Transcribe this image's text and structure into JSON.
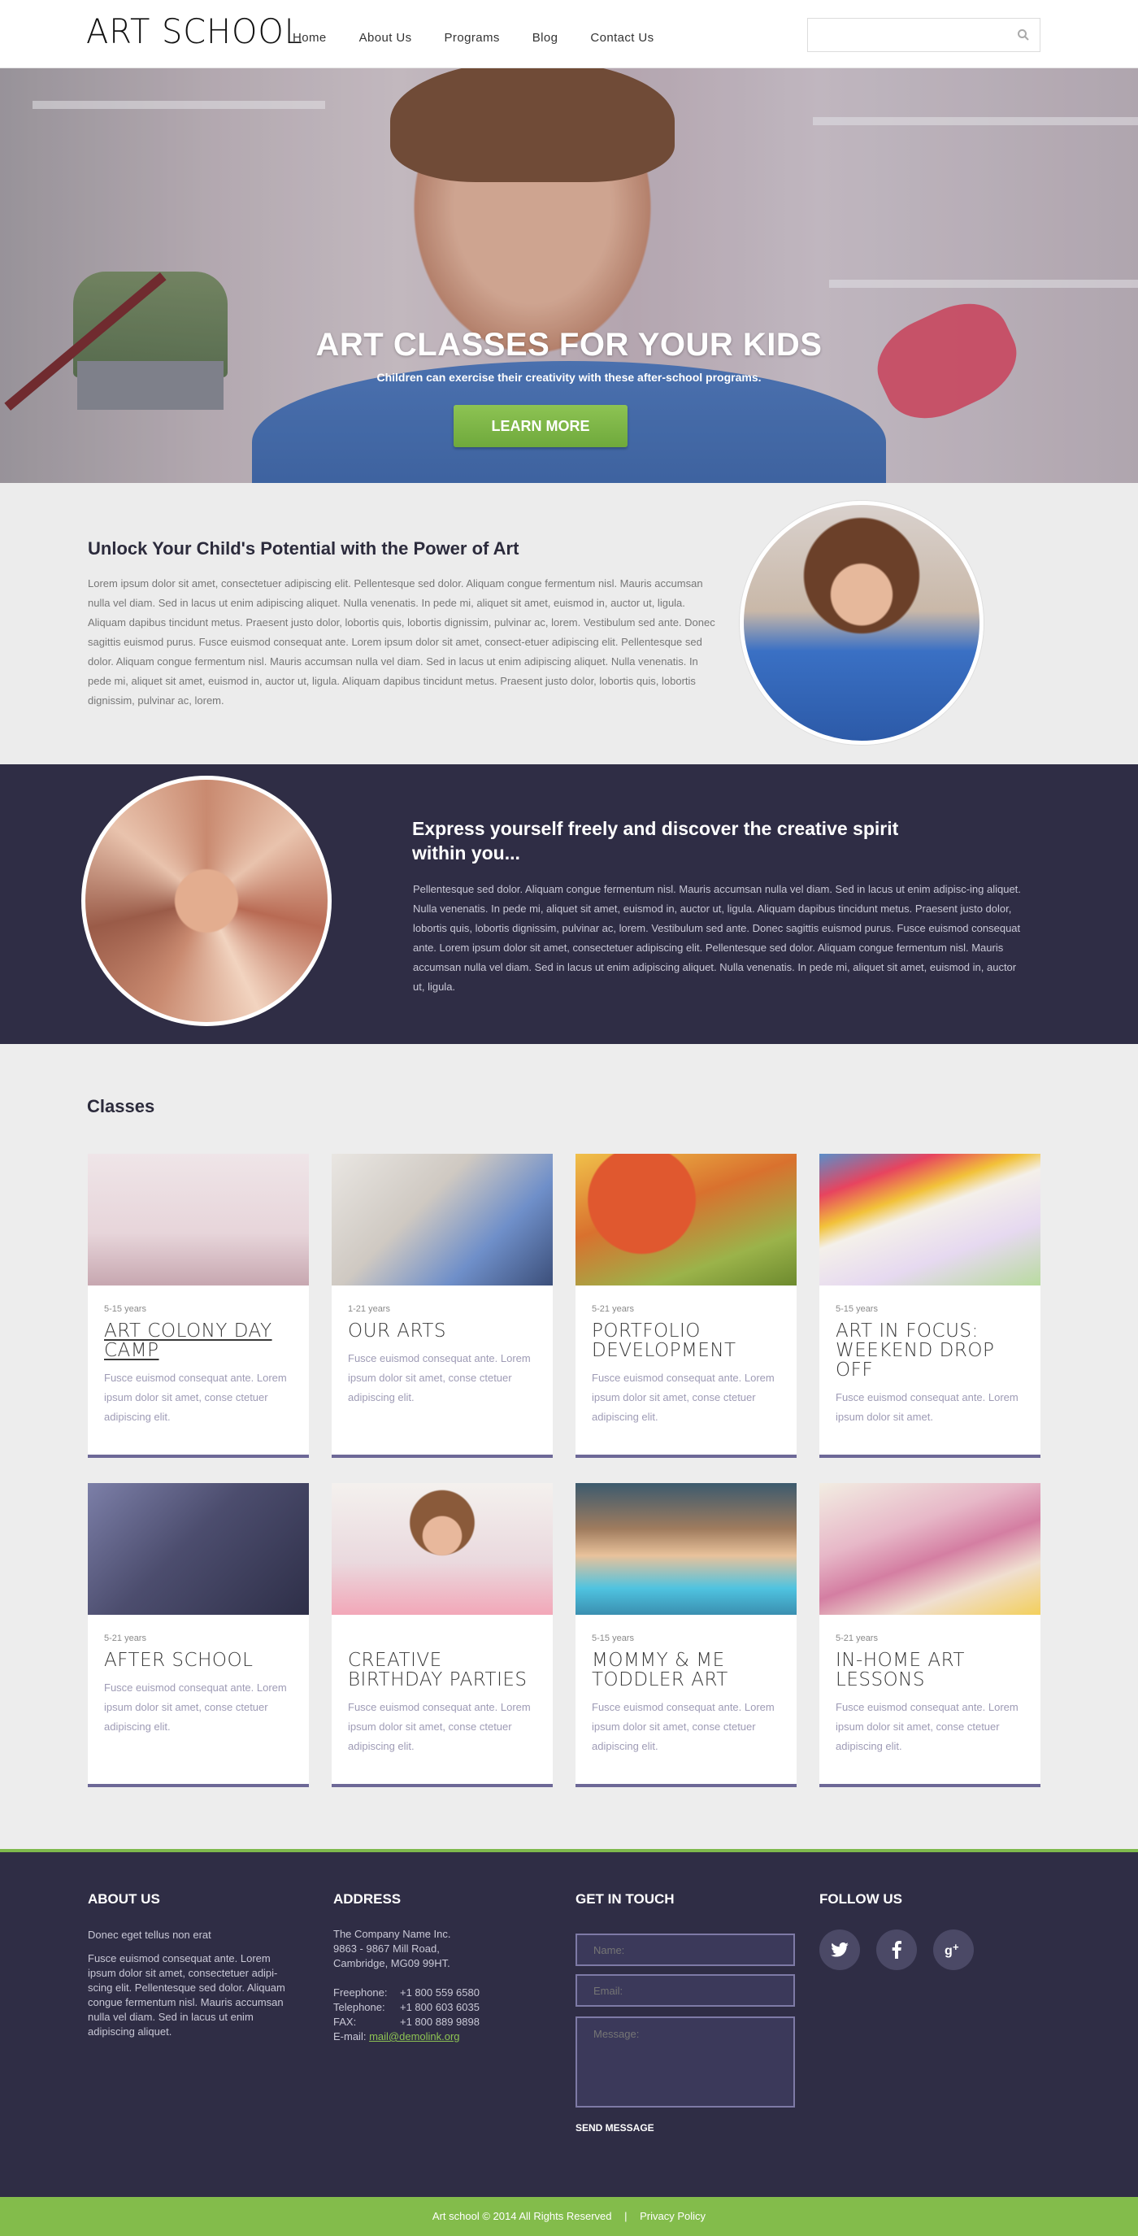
{
  "header": {
    "logo": "ART SCHOOL",
    "nav": [
      "Home",
      "About Us",
      "Programs",
      "Blog",
      "Contact Us"
    ],
    "search_placeholder": ""
  },
  "hero": {
    "title": "ART CLASSES FOR YOUR KIDS",
    "subtitle": "Children can exercise their creativity with these after-school programs.",
    "button": "LEARN MORE"
  },
  "section1": {
    "title": "Unlock Your Child's Potential with the Power of Art",
    "text": "Lorem ipsum dolor sit amet, consectetuer adipiscing elit. Pellentesque sed dolor. Aliquam congue fermentum nisl. Mauris accumsan nulla vel diam. Sed in lacus ut enim adipiscing aliquet. Nulla venenatis. In pede mi, aliquet sit amet, euismod in, auctor ut, ligula. Aliquam dapibus tincidunt metus. Praesent justo dolor, lobortis quis, lobortis dignissim, pulvinar ac, lorem. Vestibulum sed ante. Donec sagittis euismod purus. Fusce euismod consequat ante. Lorem ipsum dolor sit amet, consect-etuer adipiscing elit. Pellentesque sed dolor. Aliquam congue fermentum nisl. Mauris accumsan nulla vel diam. Sed in lacus ut enim adipiscing aliquet. Nulla venenatis. In pede mi, aliquet sit amet, euismod in, auctor ut, ligula. Aliquam dapibus tincidunt metus. Praesent justo dolor, lobortis quis, lobortis dignissim, pulvinar ac, lorem."
  },
  "section2": {
    "title": "Express yourself freely and discover the creative spirit within you...",
    "text": "Pellentesque sed dolor. Aliquam congue fermentum nisl. Mauris accumsan nulla vel diam. Sed in lacus ut enim adipisc-ing aliquet. Nulla venenatis. In pede mi, aliquet sit amet, euismod in, auctor ut, ligula. Aliquam dapibus tincidunt metus. Praesent justo dolor, lobortis quis, lobortis dignissim, pulvinar ac, lorem. Vestibulum sed ante. Donec sagittis euismod purus. Fusce euismod consequat ante. Lorem ipsum dolor sit amet, consectetuer adipiscing elit. Pellentesque sed dolor. Aliquam congue fermentum nisl. Mauris accumsan nulla vel diam. Sed in lacus ut enim adipiscing aliquet. Nulla venenatis. In pede mi, aliquet sit amet, euismod in, auctor ut, ligula."
  },
  "classes": {
    "heading": "Classes",
    "items": [
      {
        "age": "5-15 years",
        "title": "ART COLONY DAY CAMP",
        "desc": "Fusce euismod consequat ante. Lorem ipsum dolor sit amet, conse ctetuer adipiscing elit."
      },
      {
        "age": "1-21 years",
        "title": "OUR ARTS",
        "desc": "Fusce euismod consequat ante. Lorem ipsum dolor sit amet, conse ctetuer adipiscing elit."
      },
      {
        "age": "5-21 years",
        "title": "PORTFOLIO DEVELOPMENT",
        "desc": "Fusce euismod consequat ante. Lorem ipsum dolor sit amet, conse ctetuer adipiscing elit."
      },
      {
        "age": "5-15 years",
        "title": "ART IN FOCUS: WEEKEND DROP OFF",
        "desc": "Fusce euismod consequat ante. Lorem ipsum dolor sit amet."
      },
      {
        "age": "5-21 years",
        "title": "AFTER SCHOOL",
        "desc": "Fusce euismod consequat ante. Lorem ipsum dolor sit amet, conse ctetuer adipiscing elit."
      },
      {
        "age": "",
        "title": "CREATIVE BIRTHDAY PARTIES",
        "desc": "Fusce euismod consequat ante. Lorem ipsum dolor sit amet, conse ctetuer adipiscing elit."
      },
      {
        "age": "5-15 years",
        "title": "MOMMY & ME TODDLER ART",
        "desc": "Fusce euismod consequat ante. Lorem ipsum dolor sit amet, conse ctetuer adipiscing elit."
      },
      {
        "age": "5-21 years",
        "title": "In-HOME ART LESSONS",
        "desc": "Fusce euismod consequat ante. Lorem ipsum dolor sit amet, conse ctetuer adipiscing elit."
      }
    ]
  },
  "footer": {
    "about": {
      "heading": "ABOUT US",
      "lead": "Donec eget tellus non erat",
      "text": "Fusce euismod consequat ante. Lorem ipsum dolor sit amet, consectetuer adipi-scing elit. Pellentesque sed dolor. Aliquam congue fermentum nisl. Mauris accumsan nulla vel diam. Sed in lacus ut enim adipiscing aliquet."
    },
    "address": {
      "heading": "ADDRESS",
      "company": "The Company Name Inc.",
      "street": "9863 - 9867 Mill Road,",
      "city": "Cambridge, MG09 99HT.",
      "freephone_label": "Freephone:",
      "freephone": "+1 800 559 6580",
      "telephone_label": "Telephone:",
      "telephone": "+1 800 603 6035",
      "fax_label": "FAX:",
      "fax": "+1 800 889 9898",
      "email_label": "E-mail:",
      "email": "mail@demolink.org"
    },
    "contact": {
      "heading": "GET IN TOUCH",
      "name_placeholder": "Name:",
      "email_placeholder": "Email:",
      "message_placeholder": "Message:",
      "send": "SEND MESSAGE"
    },
    "follow": {
      "heading": "FOLLOW US",
      "networks": [
        "twitter",
        "facebook",
        "google-plus"
      ]
    },
    "copyright": "Art school © 2014 All Rights Reserved",
    "separator": "|",
    "privacy": "Privacy Policy"
  }
}
